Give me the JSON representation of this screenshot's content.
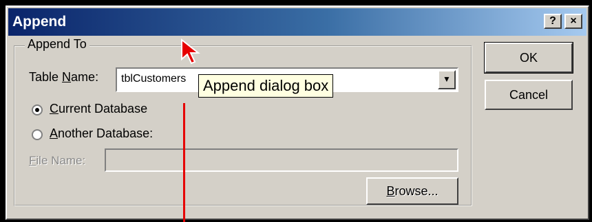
{
  "dialog": {
    "title": "Append",
    "help_button": "?",
    "close_button": "×"
  },
  "append_to": {
    "group_label": "Append To",
    "table_name_label_pre": "Table ",
    "table_name_label_u": "N",
    "table_name_label_post": "ame:",
    "table_name_value": "tblCustomers",
    "current_db_u": "C",
    "current_db_post": "urrent Database",
    "current_db_checked": true,
    "another_db_u": "A",
    "another_db_post": "nother Database:",
    "file_name_u": "F",
    "file_name_post": "ile Name:",
    "file_name_value": "",
    "browse_u": "B",
    "browse_post": "rowse..."
  },
  "buttons": {
    "ok": "OK",
    "cancel": "Cancel"
  },
  "annotation": {
    "callout_text": "Append dialog box",
    "arrow_color": "#e60000"
  },
  "icons": {
    "dropdown": "chevron-down-icon",
    "cursor": "arrow-cursor-icon"
  }
}
